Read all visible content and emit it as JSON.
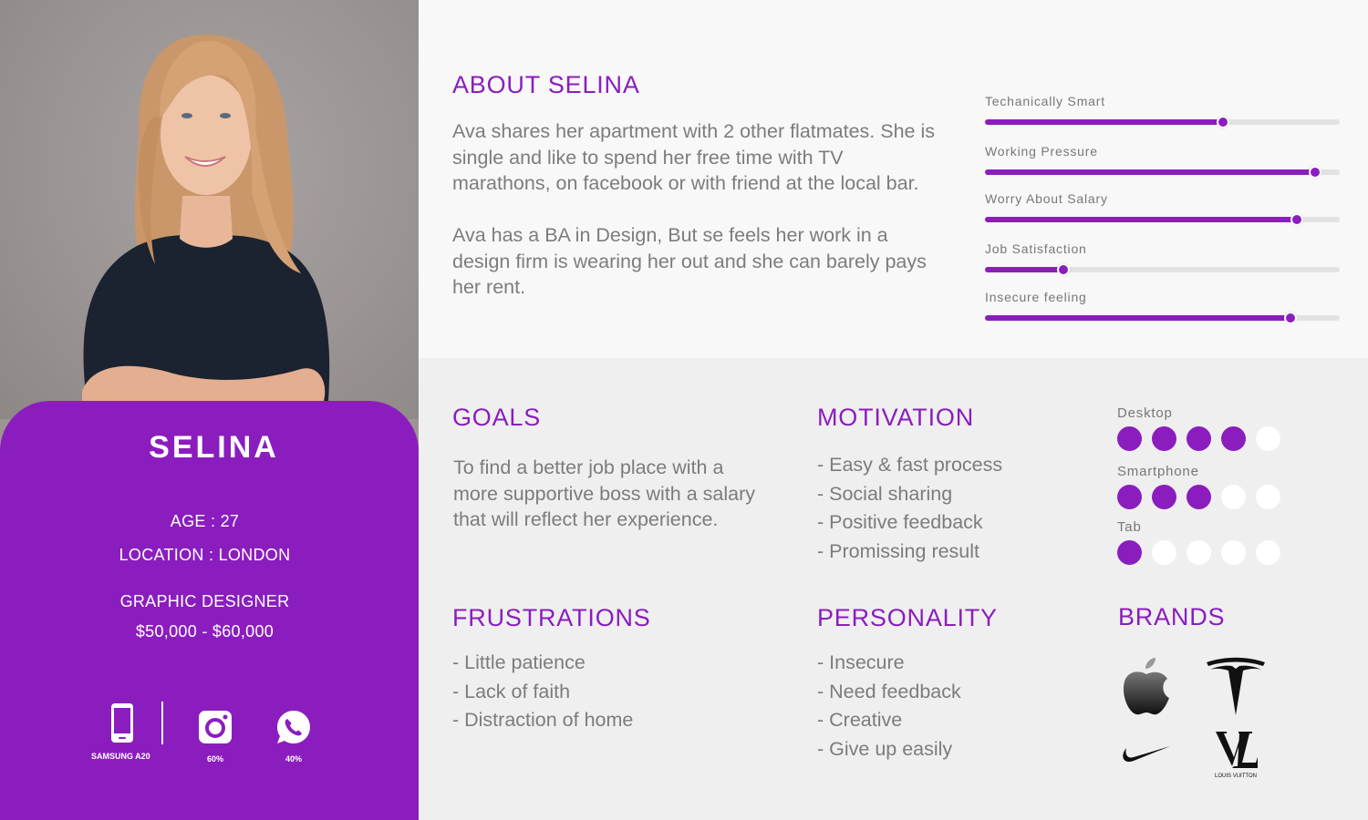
{
  "persona": {
    "name": "SELINA",
    "age": "AGE : 27",
    "location": "LOCATION : LONDON",
    "occupation": "GRAPHIC DESIGNER",
    "salary": "$50,000 - $60,000",
    "photo": "portrait-photo"
  },
  "devices": [
    {
      "icon": "smartphone-icon",
      "label": "SAMSUNG A20"
    },
    {
      "icon": "instagram-icon",
      "label": "60%"
    },
    {
      "icon": "whatsapp-icon",
      "label": "40%"
    }
  ],
  "about": {
    "title": "ABOUT SELINA",
    "paragraphs": [
      "Ava shares her apartment with 2 other flatmates. She is single and like to spend her free time with TV marathons, on facebook or with friend at the local bar.",
      "Ava has a BA in Design, But se feels her work in a design firm is wearing her out and she can barely pays her rent."
    ]
  },
  "traits": [
    {
      "label": "Techanically Smart",
      "value": 0.67
    },
    {
      "label": "Working Pressure",
      "value": 0.93
    },
    {
      "label": "Worry About Salary",
      "value": 0.88
    },
    {
      "label": "Job Satisfaction",
      "value": 0.22
    },
    {
      "label": "Insecure feeling",
      "value": 0.86
    }
  ],
  "goals": {
    "title": "GOALS",
    "text": "To find a better job place with a more supportive boss with a salary that will reflect her experience."
  },
  "motivation": {
    "title": "MOTIVATION",
    "items": [
      "- Easy & fast process",
      "- Social sharing",
      "- Positive feedback",
      "- Promissing result"
    ]
  },
  "frustrations": {
    "title": "FRUSTRATIONS",
    "items": [
      "- Little patience",
      "- Lack of faith",
      "- Distraction of home"
    ]
  },
  "personality": {
    "title": "PERSONALITY",
    "items": [
      "- Insecure",
      "- Need feedback",
      "- Creative",
      "- Give up easily"
    ]
  },
  "device_usage": [
    {
      "label": "Desktop",
      "rating": 4,
      "max": 5
    },
    {
      "label": "Smartphone",
      "rating": 3,
      "max": 5
    },
    {
      "label": "Tab",
      "rating": 1,
      "max": 5
    }
  ],
  "brands": {
    "title": "BRANDS",
    "items": [
      {
        "name": "apple-logo"
      },
      {
        "name": "tesla-logo"
      },
      {
        "name": "nike-logo"
      },
      {
        "name": "louis-vuitton-logo",
        "caption": "LOUIS VUITTON"
      }
    ]
  },
  "colors": {
    "accent": "#8b1dbf",
    "top_bg": "#f8f8f8",
    "bottom_bg": "#efefef",
    "track": "#e2e2e2",
    "text": "#7c7c7c"
  }
}
